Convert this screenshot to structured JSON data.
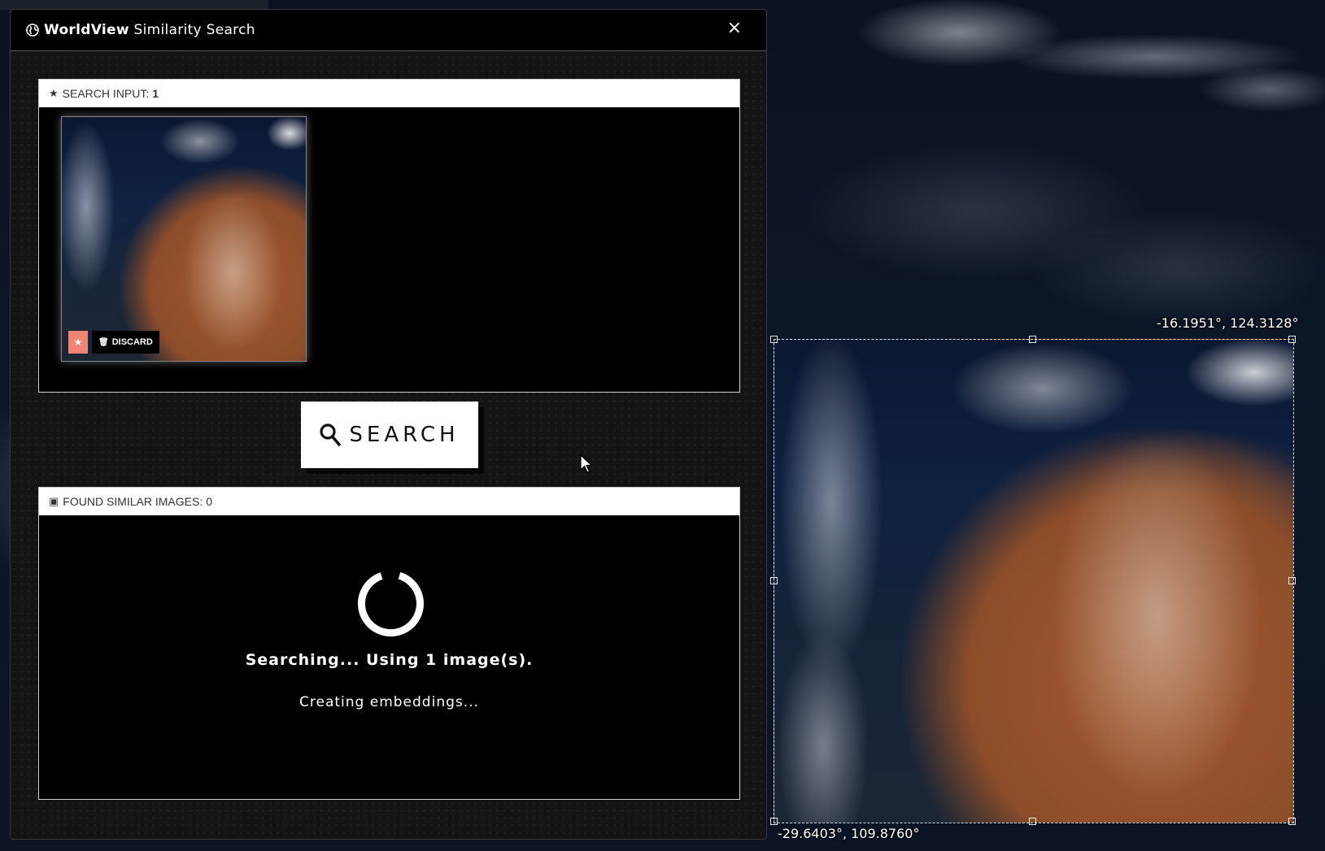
{
  "modal": {
    "title_strong": "WorldView",
    "title_rest": " Similarity Search",
    "close_label": "×"
  },
  "search_input": {
    "header_label": "SEARCH INPUT:",
    "count": "1",
    "discard_label": "DISCARD"
  },
  "search_button": {
    "label": "SEARCH"
  },
  "results": {
    "header_label": "FOUND SIMILAR IMAGES:",
    "count": "0",
    "status_main": "Searching... Using 1 image(s).",
    "status_sub": "Creating embeddings..."
  },
  "map": {
    "coord_top_right": "-16.1951°, 124.3128°",
    "coord_bottom_left": "-29.6403°, 109.8760°"
  },
  "colors": {
    "accent_star_button": "#f08575",
    "panel_header_bg": "#ffffff",
    "modal_bg": "#141414"
  },
  "icons": [
    "globe-icon",
    "close-icon",
    "star-icon",
    "trash-icon",
    "image-icon",
    "search-icon",
    "spinner-icon",
    "cursor-icon"
  ]
}
